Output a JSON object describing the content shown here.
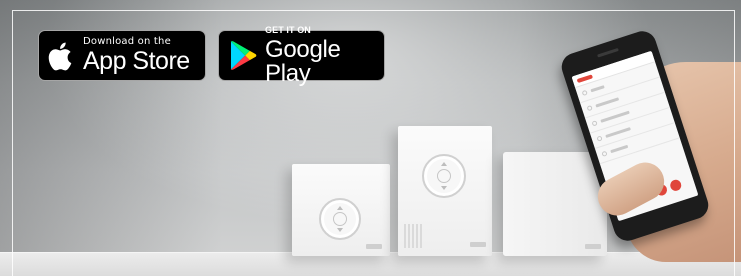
{
  "badges": {
    "app_store": {
      "small_text": "Download on the",
      "big_text": "App Store",
      "icon": "apple-icon"
    },
    "google_play": {
      "small_text": "GET IT ON",
      "big_text": "Google Play",
      "icon": "google-play-icon"
    }
  },
  "colors": {
    "badge_bg": "#000000",
    "badge_text": "#ffffff",
    "app_accent": "#e0463b"
  },
  "scene": {
    "devices": [
      "wall-control-left",
      "wall-control-center",
      "hub-unit-right"
    ],
    "phone_app_rows": 5,
    "phone_action_buttons": 3
  }
}
